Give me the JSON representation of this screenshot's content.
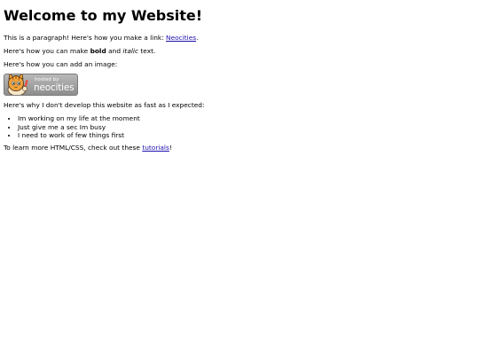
{
  "heading": "Welcome to my Website!",
  "para1": {
    "before": "This is a paragraph! Here's how you make a link: ",
    "link": "Neocities",
    "after": "."
  },
  "para2": {
    "before": "Here's how you can make ",
    "bold": "bold",
    "middle": " and ",
    "italic": "italic",
    "after": " text."
  },
  "para3": "Here's how you can add an image:",
  "badge": {
    "image_text_top": "hosted by",
    "image_text_brand": "neocities",
    "icon": "neocities-cat-icon"
  },
  "para4": "Here's why I don't develop this website as fast as I expected:",
  "reasons": [
    "Im working on my life at the moment",
    "Just give me a sec Im busy",
    "I need to work of few things first"
  ],
  "para5": {
    "before": "To learn more HTML/CSS, check out these ",
    "link": "tutorials",
    "after": "!"
  },
  "colors": {
    "link": "#1a0dab",
    "badge_bg": "#9e9e9e",
    "cat_orange": "#f2a33a"
  }
}
